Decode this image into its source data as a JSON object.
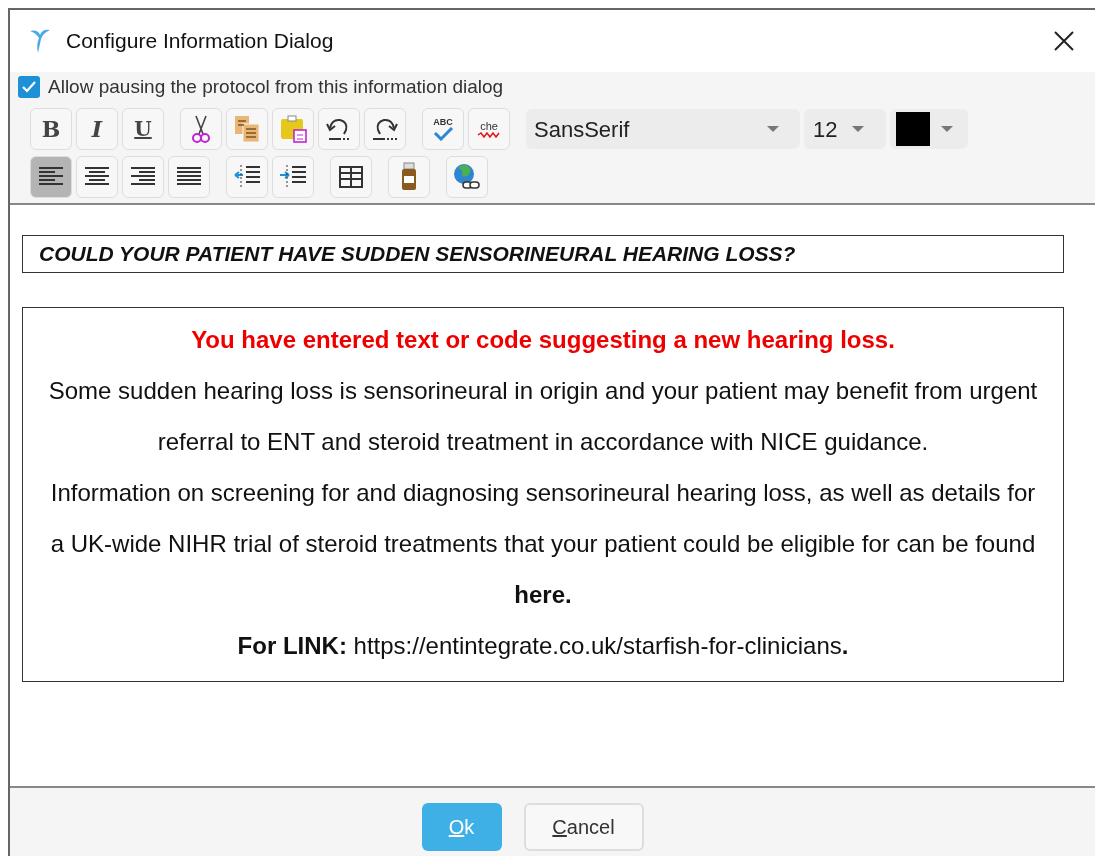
{
  "window": {
    "title": "Configure Information Dialog"
  },
  "allow_pausing": {
    "label": "Allow pausing the protocol from this information dialog",
    "checked": true
  },
  "toolbar_row_1": [
    {
      "kind": "bold",
      "glyph": "B"
    },
    {
      "kind": "italic",
      "glyph": "I"
    },
    {
      "kind": "underline",
      "glyph": "U"
    },
    {
      "kind": "sep"
    },
    {
      "kind": "cut"
    },
    {
      "kind": "copy"
    },
    {
      "kind": "paste"
    },
    {
      "kind": "undo"
    },
    {
      "kind": "redo"
    },
    {
      "kind": "sep"
    },
    {
      "kind": "spellcheck",
      "glyph": "ABC"
    },
    {
      "kind": "spellcheck_live",
      "glyph": "che"
    }
  ],
  "font_family": {
    "value": "SansSerif"
  },
  "font_size": {
    "value": "12"
  },
  "text_color": {
    "color": "#000000"
  },
  "toolbar_row_2": [
    {
      "kind": "align_left",
      "selected": true
    },
    {
      "kind": "align_center",
      "selected": false
    },
    {
      "kind": "align_right",
      "selected": false
    },
    {
      "kind": "justify",
      "selected": false
    },
    {
      "kind": "sep"
    },
    {
      "kind": "outdent",
      "selected": false
    },
    {
      "kind": "indent",
      "selected": false
    },
    {
      "kind": "sep"
    },
    {
      "kind": "table",
      "selected": false
    },
    {
      "kind": "sep"
    },
    {
      "kind": "bottle",
      "selected": false
    },
    {
      "kind": "sep"
    },
    {
      "kind": "link",
      "selected": false
    }
  ],
  "heading": "COULD YOUR PATIENT HAVE SUDDEN SENSORINEURAL HEARING LOSS?",
  "paragraphs": [
    {
      "kind": "alert",
      "text": "You have entered text or code suggesting a new hearing loss."
    },
    {
      "kind": "normal",
      "text": "Some sudden hearing loss is sensorineural in origin and your patient may benefit from urgent referral to ENT and steroid treatment in accordance with NICE guidance."
    },
    {
      "kind": "normal",
      "text": "Information on screening for and diagnosing sensorineural hearing loss, as well as details for a UK-wide NIHR trial of steroid treatments that your patient could be eligible for can be found **here.**"
    },
    {
      "kind": "normal",
      "text": "**For LINK:** https://entintegrate.co.uk/starfish-for-clinicians**.**"
    }
  ],
  "buttons": [
    {
      "label_parts": [
        {
          "text": "O",
          "underlined": true
        },
        {
          "text": "k",
          "underlined": false
        }
      ],
      "primary": true
    },
    {
      "label_parts": [
        {
          "text": "C",
          "underlined": true
        },
        {
          "text": "ancel",
          "underlined": false
        }
      ],
      "primary": false
    }
  ]
}
